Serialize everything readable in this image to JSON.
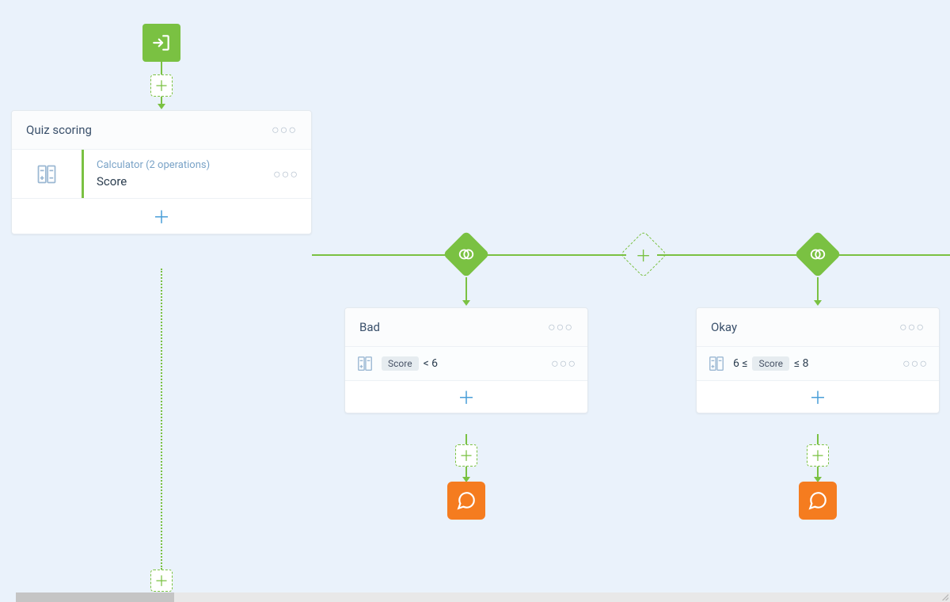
{
  "start": {},
  "quizCard": {
    "title": "Quiz scoring",
    "calcSub": "Calculator (2 operations)",
    "calcMain": "Score"
  },
  "badCard": {
    "title": "Bad",
    "tag": "Score",
    "op": "< 6"
  },
  "okayCard": {
    "title": "Okay",
    "pre": "6 ≤",
    "tag": "Score",
    "post": "≤ 8"
  }
}
